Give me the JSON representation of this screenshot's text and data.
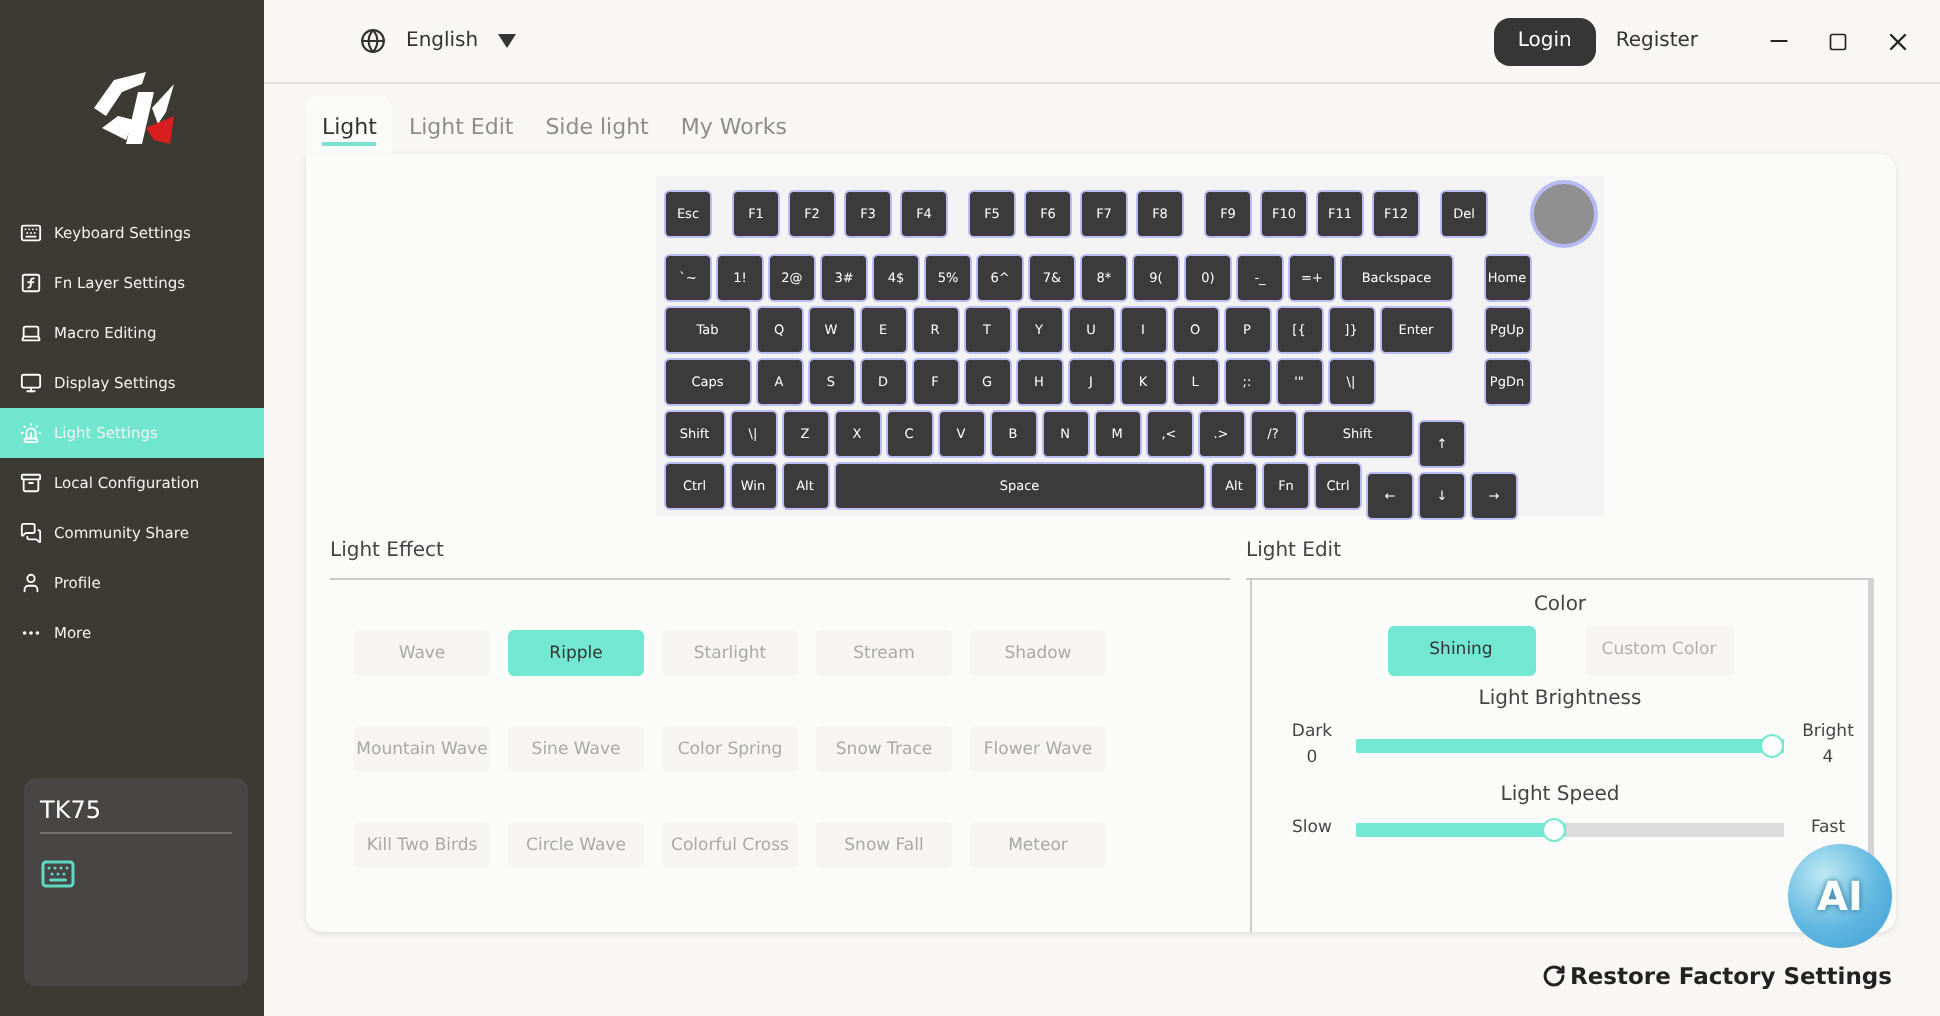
{
  "sidebar": {
    "items": [
      {
        "label": "Keyboard Settings",
        "selected": false
      },
      {
        "label": "Fn Layer Settings",
        "selected": false
      },
      {
        "label": "Macro Editing",
        "selected": false
      },
      {
        "label": "Display Settings",
        "selected": false
      },
      {
        "label": "Light Settings",
        "selected": true
      },
      {
        "label": "Local Configuration",
        "selected": false
      },
      {
        "label": "Community Share",
        "selected": false
      },
      {
        "label": "Profile",
        "selected": false
      },
      {
        "label": "More",
        "selected": false
      }
    ],
    "device": {
      "name": "TK75"
    }
  },
  "header": {
    "language": "English",
    "login": "Login",
    "register": "Register"
  },
  "tabs": [
    {
      "label": "Light",
      "selected": true
    },
    {
      "label": "Light Edit",
      "selected": false
    },
    {
      "label": "Side light",
      "selected": false
    },
    {
      "label": "My Works",
      "selected": false
    }
  ],
  "keyboard": {
    "function_row": [
      [
        "Esc"
      ],
      [
        "F1",
        "F2",
        "F3",
        "F4"
      ],
      [
        "F5",
        "F6",
        "F7",
        "F8"
      ],
      [
        "F9",
        "F10",
        "F11",
        "F12"
      ],
      [
        "Del"
      ]
    ],
    "rows": [
      {
        "keys": [
          {
            "label": "`~",
            "kind": "key"
          },
          {
            "label": "1!",
            "kind": "key"
          },
          {
            "label": "2@",
            "kind": "key"
          },
          {
            "label": "3#",
            "kind": "key"
          },
          {
            "label": "4$",
            "kind": "key"
          },
          {
            "label": "5%",
            "kind": "key"
          },
          {
            "label": "6^",
            "kind": "key"
          },
          {
            "label": "7&",
            "kind": "key"
          },
          {
            "label": "8*",
            "kind": "key"
          },
          {
            "label": "9(",
            "kind": "key"
          },
          {
            "label": "0)",
            "kind": "key"
          },
          {
            "label": "-_",
            "kind": "key"
          },
          {
            "label": "=+",
            "kind": "key"
          },
          {
            "label": "Backspace",
            "kind": "long"
          },
          {
            "label": "Home",
            "kind": "nav"
          }
        ]
      },
      {
        "keys": [
          {
            "label": "Tab",
            "kind": "wide"
          },
          {
            "label": "Q",
            "kind": "key"
          },
          {
            "label": "W",
            "kind": "key"
          },
          {
            "label": "E",
            "kind": "key"
          },
          {
            "label": "R",
            "kind": "key"
          },
          {
            "label": "T",
            "kind": "key"
          },
          {
            "label": "Y",
            "kind": "key"
          },
          {
            "label": "U",
            "kind": "key"
          },
          {
            "label": "I",
            "kind": "key"
          },
          {
            "label": "O",
            "kind": "key"
          },
          {
            "label": "P",
            "kind": "key"
          },
          {
            "label": "[{",
            "kind": "key"
          },
          {
            "label": "]}",
            "kind": "key"
          },
          {
            "label": "Enter",
            "kind": "enter"
          },
          {
            "label": "PgUp",
            "kind": "nav"
          }
        ]
      },
      {
        "keys": [
          {
            "label": "Caps",
            "kind": "wide"
          },
          {
            "label": "A",
            "kind": "key"
          },
          {
            "label": "S",
            "kind": "key"
          },
          {
            "label": "D",
            "kind": "key"
          },
          {
            "label": "F",
            "kind": "key"
          },
          {
            "label": "G",
            "kind": "key"
          },
          {
            "label": "H",
            "kind": "key"
          },
          {
            "label": "J",
            "kind": "key"
          },
          {
            "label": "K",
            "kind": "key"
          },
          {
            "label": "L",
            "kind": "key"
          },
          {
            "label": ";:",
            "kind": "key"
          },
          {
            "label": "'\"",
            "kind": "key"
          },
          {
            "label": "\\|",
            "kind": "key"
          },
          {
            "label": "PgDn",
            "kind": "nav"
          }
        ]
      },
      {
        "keys": [
          {
            "label": "Shift",
            "kind": "mod"
          },
          {
            "label": "\\|",
            "kind": "key"
          },
          {
            "label": "Z",
            "kind": "key"
          },
          {
            "label": "X",
            "kind": "key"
          },
          {
            "label": "C",
            "kind": "key"
          },
          {
            "label": "V",
            "kind": "key"
          },
          {
            "label": "B",
            "kind": "key"
          },
          {
            "label": "N",
            "kind": "key"
          },
          {
            "label": "M",
            "kind": "key"
          },
          {
            "label": ",<",
            "kind": "key"
          },
          {
            "label": ".>",
            "kind": "key"
          },
          {
            "label": "/?",
            "kind": "key"
          },
          {
            "label": "Shift",
            "kind": "long"
          },
          {
            "label": "↑",
            "kind": "arrow"
          }
        ]
      },
      {
        "keys": [
          {
            "label": "Ctrl",
            "kind": "mod"
          },
          {
            "label": "Win",
            "kind": "key"
          },
          {
            "label": "Alt",
            "kind": "key"
          },
          {
            "label": "Space",
            "kind": "space"
          },
          {
            "label": "Alt",
            "kind": "key"
          },
          {
            "label": "Fn",
            "kind": "key"
          },
          {
            "label": "Ctrl",
            "kind": "key"
          },
          {
            "label": "←",
            "kind": "arrow"
          },
          {
            "label": "↓",
            "kind": "arrow"
          },
          {
            "label": "→",
            "kind": "arrow"
          }
        ]
      }
    ]
  },
  "light_effect": {
    "title": "Light Effect",
    "effects": [
      {
        "label": "Wave",
        "selected": false
      },
      {
        "label": "Ripple",
        "selected": true
      },
      {
        "label": "Starlight",
        "selected": false
      },
      {
        "label": "Stream",
        "selected": false
      },
      {
        "label": "Shadow",
        "selected": false
      },
      {
        "label": "Mountain Wave",
        "selected": false
      },
      {
        "label": "Sine Wave",
        "selected": false
      },
      {
        "label": "Color Spring",
        "selected": false
      },
      {
        "label": "Snow Trace",
        "selected": false
      },
      {
        "label": "Flower Wave",
        "selected": false
      },
      {
        "label": "Kill Two Birds",
        "selected": false
      },
      {
        "label": "Circle Wave",
        "selected": false
      },
      {
        "label": "Colorful Cross",
        "selected": false
      },
      {
        "label": "Snow Fall",
        "selected": false
      },
      {
        "label": "Meteor",
        "selected": false
      }
    ]
  },
  "light_edit": {
    "title": "Light Edit",
    "color_title": "Color",
    "color_options": [
      {
        "label": "Shining",
        "selected": true
      },
      {
        "label": "Custom Color",
        "selected": false
      }
    ],
    "brightness": {
      "title": "Light Brightness",
      "min_label": "Dark",
      "min_value": "0",
      "max_label": "Bright",
      "max_value": "4",
      "level": 1
    },
    "speed": {
      "title": "Light Speed",
      "min_label": "Slow",
      "max_label": "Fast",
      "level": 0.49
    }
  },
  "ai_button": {
    "label": "AI"
  },
  "restore": {
    "label": "Restore Factory Settings"
  }
}
